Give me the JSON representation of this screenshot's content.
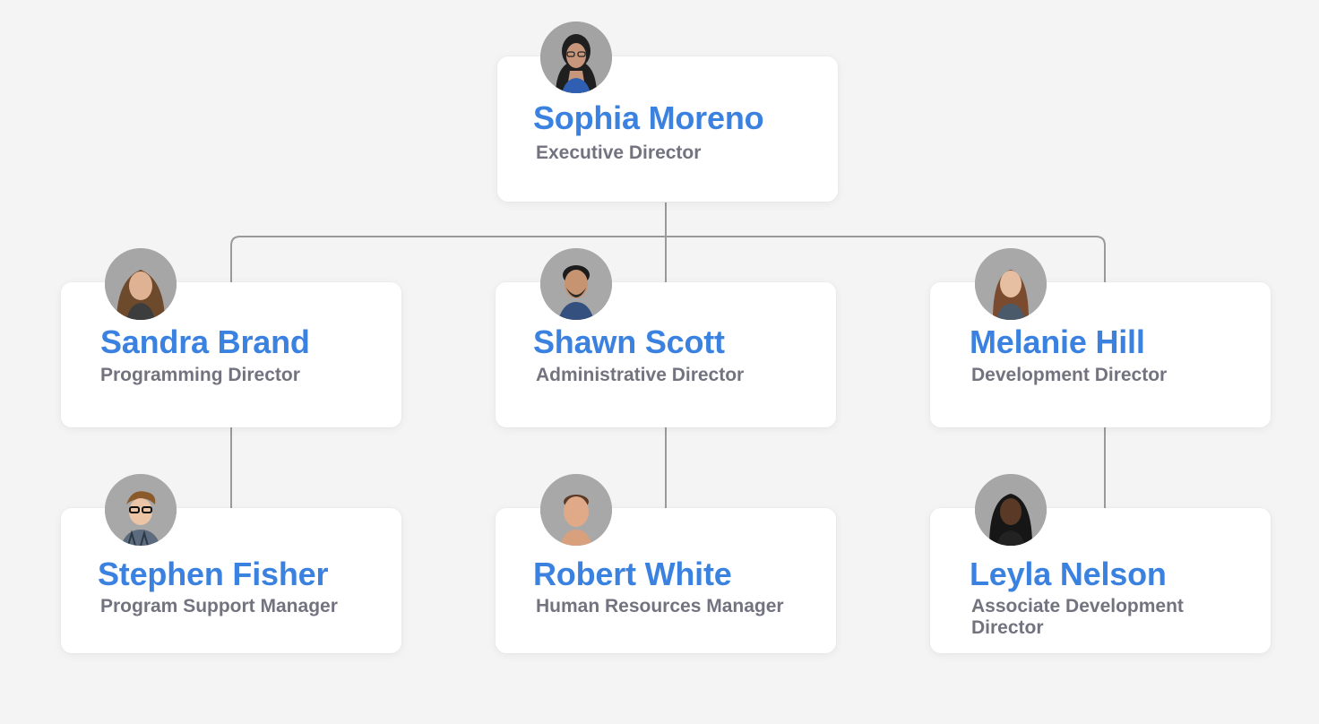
{
  "org_chart": {
    "root": {
      "name": "Sophia Moreno",
      "role": "Executive Director",
      "avatar_icon": "person-avatar-icon"
    },
    "directors": [
      {
        "name": "Sandra Brand",
        "role": "Programming Director",
        "avatar_icon": "person-avatar-icon",
        "report": {
          "name": "Stephen Fisher",
          "role": "Program Support Manager",
          "avatar_icon": "person-avatar-icon"
        }
      },
      {
        "name": "Shawn Scott",
        "role": "Administrative Director",
        "avatar_icon": "person-avatar-icon",
        "report": {
          "name": "Robert White",
          "role": "Human Resources Manager",
          "avatar_icon": "person-avatar-icon"
        }
      },
      {
        "name": "Melanie Hill",
        "role": "Development Director",
        "avatar_icon": "person-avatar-icon",
        "report": {
          "name": "Leyla Nelson",
          "role": "Associate Development Director",
          "avatar_icon": "person-avatar-icon"
        }
      }
    ]
  },
  "colors": {
    "background": "#f4f4f5",
    "card": "#ffffff",
    "name": "#3b82e0",
    "role": "#737380",
    "connector": "#9a9a9a"
  }
}
